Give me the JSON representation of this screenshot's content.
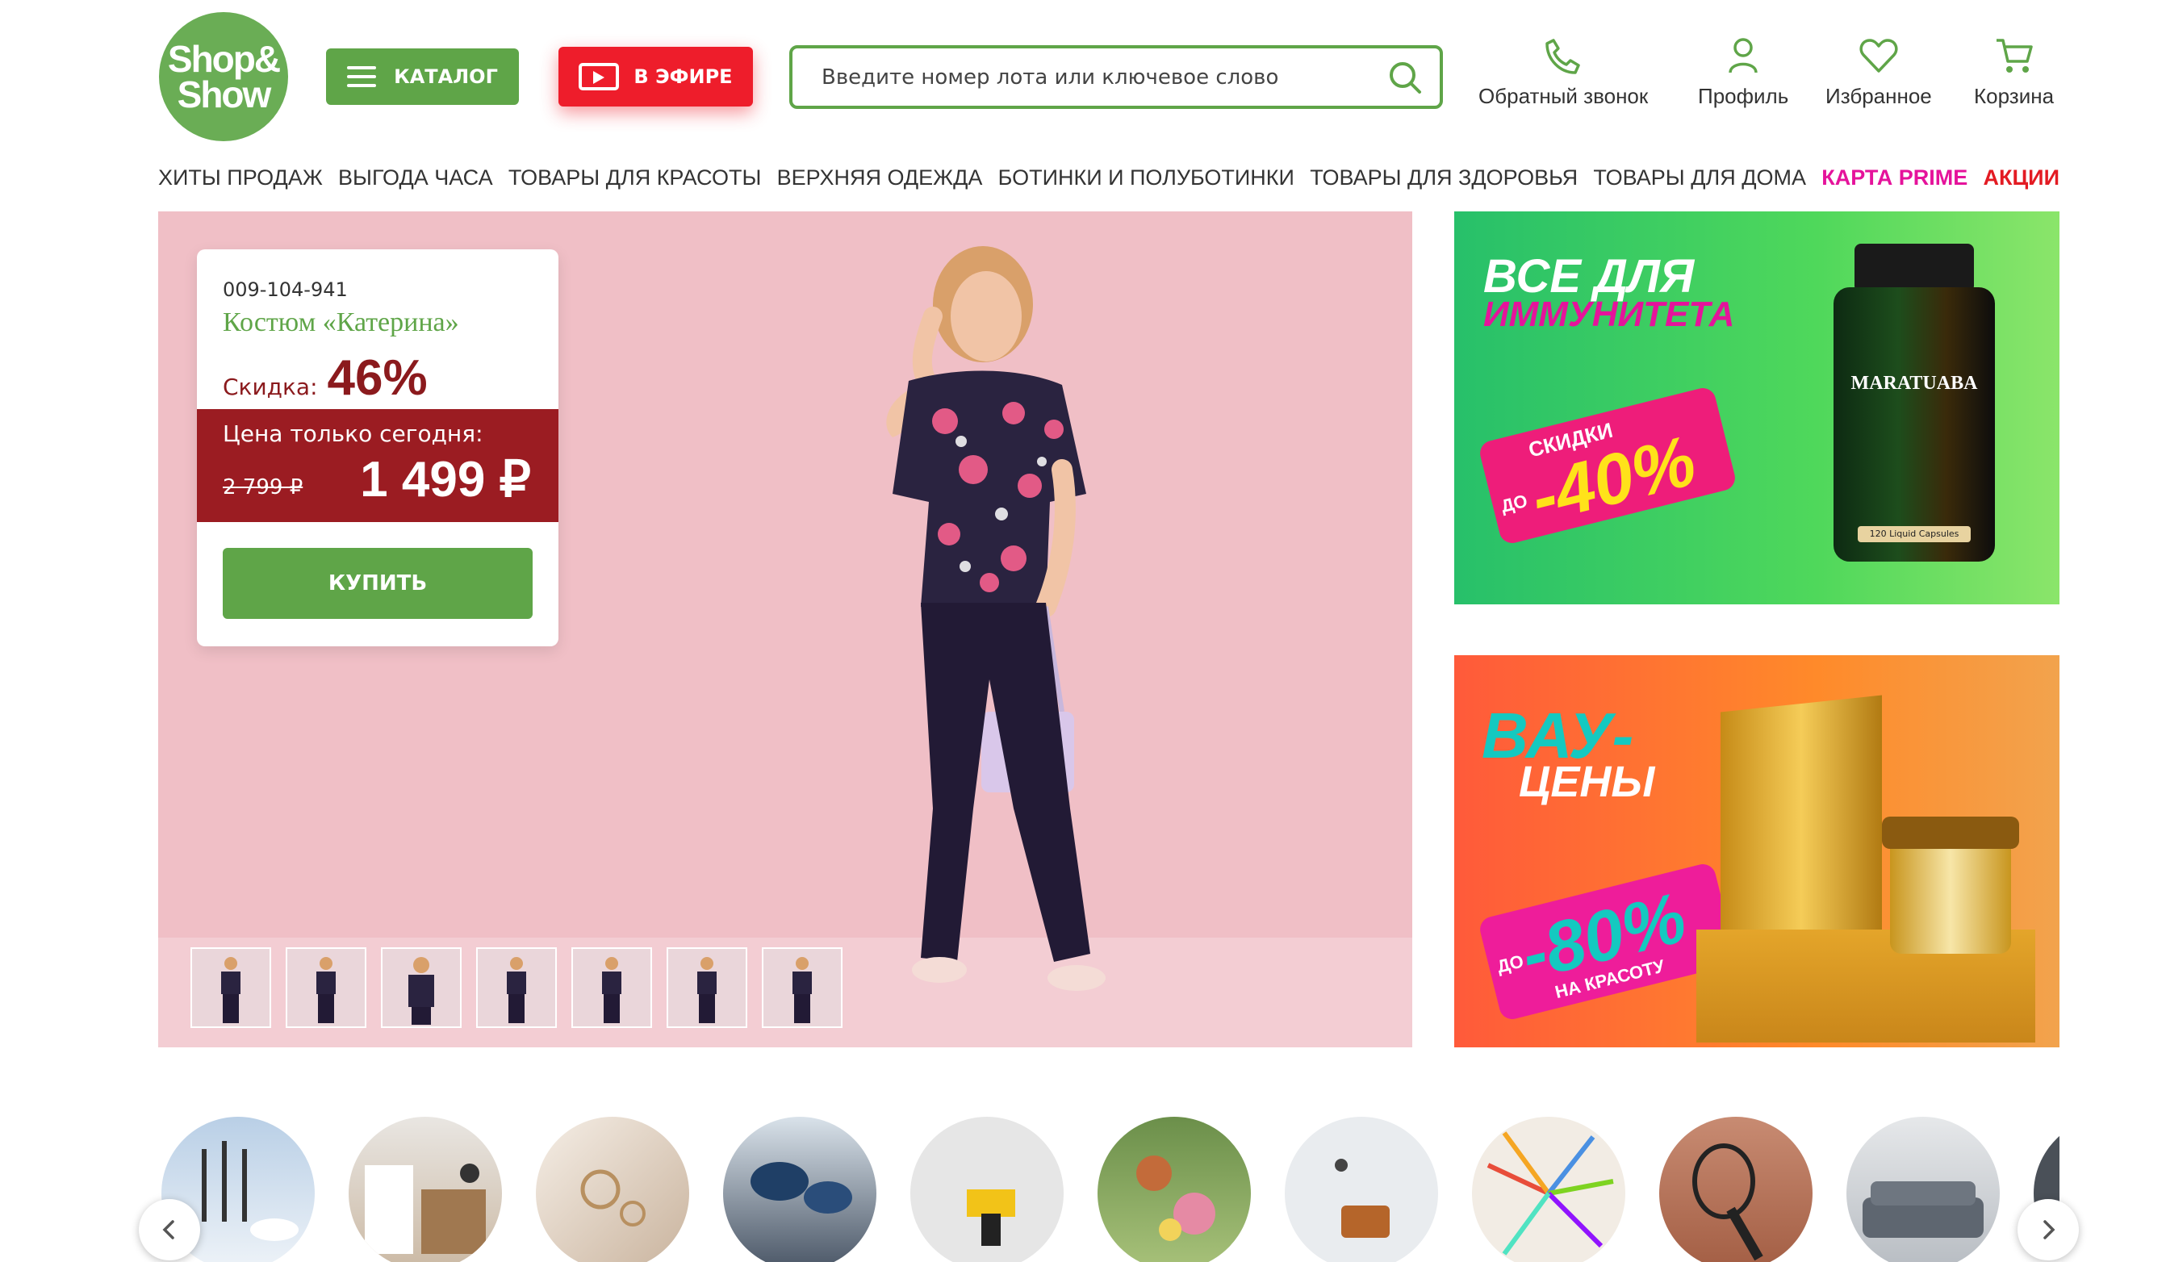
{
  "logo": {
    "line1": "Shop&",
    "line2": "Show"
  },
  "header": {
    "catalog_label": "КАТАЛОГ",
    "live_label": "В ЭФИРЕ",
    "search_placeholder": "Введите номер лота или ключевое слово",
    "actions": [
      "Обратный звонок",
      "Профиль",
      "Избранное",
      "Корзина"
    ]
  },
  "nav": [
    "ХИТЫ ПРОДАЖ",
    "ВЫГОДА ЧАСА",
    "ТОВАРЫ ДЛЯ КРАСОТЫ",
    "ВЕРХНЯЯ ОДЕЖДА",
    "БОТИНКИ И ПОЛУБОТИНКИ",
    "ТОВАРЫ ДЛЯ ЗДОРОВЬЯ",
    "ТОВАРЫ ДЛЯ ДОМА",
    "КАРТА PRIME",
    "АКЦИИ"
  ],
  "hero": {
    "lot_number": "009-104-941",
    "product_name": "Костюм «Катерина»",
    "discount_label": "Скидка:",
    "discount_value": "46%",
    "price_caption": "Цена только сегодня:",
    "old_price": "2 799 ₽",
    "new_price": "1 499 ₽",
    "buy_label": "КУПИТЬ"
  },
  "banner_immunity": {
    "title_line1": "ВСЕ ДЛЯ",
    "title_line2": "ИММУНИТЕТА",
    "tag_top": "СКИДКИ",
    "tag_prefix": "ДО",
    "tag_value": "-40%",
    "product_brand": "MARATUABA",
    "product_sub": "120 Liquid Capsules"
  },
  "banner_wow": {
    "title_line1": "ВАУ-",
    "title_line2": "ЦЕНЫ",
    "tag_prefix": "ДО",
    "tag_value": "-80%",
    "tag_bottom": "НА КРАСОТУ"
  },
  "colors": {
    "brand_green": "#5fa548",
    "live_red": "#ee1d2b",
    "prime_pink": "#e5139b",
    "sale_red": "#e31b23",
    "price_red": "#9b1c22"
  }
}
